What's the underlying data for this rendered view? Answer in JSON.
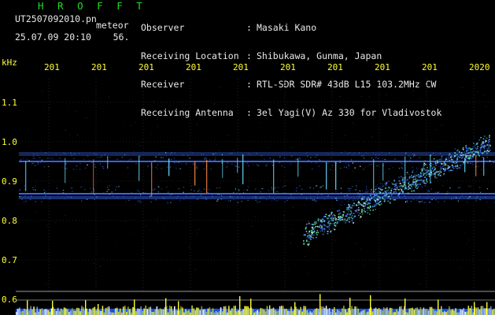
{
  "header": {
    "brand": "H R O F F T",
    "filename": "UT2507092010.pn",
    "meteor_label": "meteor",
    "datetime": "25.07.09 20:10    56.",
    "rows": [
      {
        "label": "Observer",
        "colon": ":",
        "value": "Masaki Kano"
      },
      {
        "label": "Receiving Location",
        "colon": ":",
        "value": "Shibukawa, Gunma, Japan"
      },
      {
        "label": "Receiver",
        "colon": ":",
        "value": "RTL-SDR SDR# 43dB L15 103.2MHz CW"
      },
      {
        "label": "Receiving Antenna",
        "colon": ":",
        "value": "3el Yagi(V) Az 330 for Vladivostok"
      }
    ]
  },
  "axes": {
    "y_unit": "kHz",
    "y_ticks": [
      "1.1",
      "1.0",
      "0.9",
      "0.8",
      "0.7",
      "0.6"
    ],
    "x_ticks": [
      "201",
      "201",
      "201",
      "201",
      "201",
      "201",
      "201",
      "201",
      "201",
      "2020"
    ]
  },
  "colors": {
    "background": "#000000",
    "text": "#e8e8e8",
    "accent_yellow": "#ffff33",
    "brand_green": "#22dd22",
    "signal_blue": "#3a6cff",
    "signal_cyan": "#66ddff"
  }
}
